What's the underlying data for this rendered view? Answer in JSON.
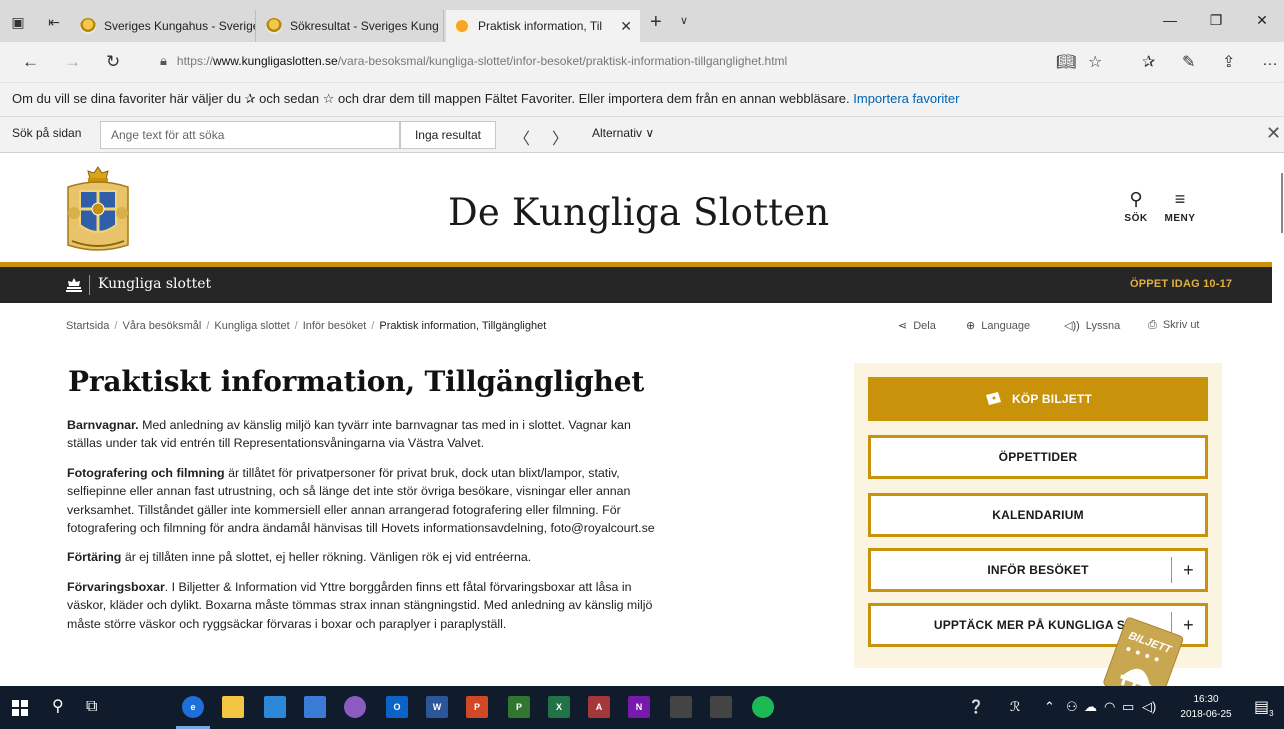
{
  "browser": {
    "tabs": [
      {
        "title": "Sveriges Kungahus - Sverige",
        "active": false
      },
      {
        "title": "Sökresultat - Sveriges Kung",
        "active": false
      },
      {
        "title": "Praktisk information, Til",
        "active": true
      }
    ],
    "tab_close_glyph": "✕",
    "new_tab_glyph": "+",
    "tab_list_glyph": "∨",
    "window_controls": {
      "minimize": "—",
      "restore": "❐",
      "close": "✕"
    },
    "nav": {
      "back": "←",
      "forward": "→",
      "refresh": "↻"
    },
    "url": {
      "prefix": "https://",
      "domain": "www.kungligaslotten.se",
      "path": "/vara-besoksmal/kungliga-slottet/infor-besoket/praktisk-information-tillganglighet.html"
    },
    "toolbar_icons": [
      "reading-view-icon",
      "favorite-star-icon",
      "favorites-hub-icon",
      "web-note-icon",
      "share-icon",
      "more-icon"
    ],
    "favbar": {
      "text": "Om du vill se dina favoriter här väljer du ✰ och sedan ☆ och drar dem till mappen Fältet Favoriter. Eller importera dem från en annan webbläsare.",
      "link": "Importera favoriter"
    },
    "find": {
      "label": "Sök på sidan",
      "placeholder": "Ange text för att söka",
      "result": "Inga resultat",
      "options": "Alternativ ∨",
      "prev": "〈",
      "next": "〉",
      "close": "✕"
    }
  },
  "site": {
    "title": "De Kungliga Slotten",
    "search_label": "SÖK",
    "menu_label": "MENY",
    "subnav_name": "Kungliga slottet",
    "open_today": "ÖPPET IDAG 10-17"
  },
  "breadcrumb": {
    "items": [
      "Startsida",
      "Våra besöksmål",
      "Kungliga slottet",
      "Inför besöket"
    ],
    "current": "Praktisk information, Tillgänglighet",
    "separator": "/"
  },
  "tools": {
    "share": "Dela",
    "language": "Language",
    "listen": "Lyssna",
    "print": "Skriv ut"
  },
  "article": {
    "title": "Praktiskt information, Tillgänglighet",
    "paragraphs": [
      {
        "lead": "Barnvagnar.",
        "text": " Med anledning av känslig miljö kan tyvärr inte barnvagnar tas med in i slottet. Vagnar kan ställas under tak vid entrén till Representationsvåningarna via Västra Valvet."
      },
      {
        "lead": "Fotografering och filmning",
        "text": " är tillåtet för privatpersoner för privat bruk, dock utan blixt/lampor, stativ, selfiepinne eller annan fast utrustning, och så länge det inte stör övriga besökare, visningar eller annan verksamhet. Tillståndet gäller inte kommersiell eller annan arrangerad fotografering eller filmning. För fotografering och filmning för andra ändamål hänvisas till Hovets informationsavdelning, foto@royalcourt.se"
      },
      {
        "lead": "Förtäring",
        "text": " är ej tillåten inne på slottet, ej heller rökning. Vänligen rök ej vid entréerna."
      },
      {
        "lead": "Förvaringsboxar",
        "text": ". I Biljetter & Information vid Yttre borggården finns ett fåtal förvaringsboxar att låsa in väskor, kläder och dylikt. Boxarna måste tömmas strax innan stängningstid. Med anledning av känslig miljö måste större väskor och ryggsäckar förvaras i boxar och paraplyer i paraplyställ."
      }
    ]
  },
  "sidebar": {
    "buy_ticket": "KÖP BILJETT",
    "opening_hours": "ÖPPETTIDER",
    "calendar": "KALENDARIUM",
    "before_visit": "INFÖR BESÖKET",
    "discover_more": "UPPTÄCK MER PÅ KUNGLIGA SLO",
    "plus": "+",
    "ticket_badge": "BILJETT"
  },
  "taskbar": {
    "apps": [
      {
        "name": "file-explorer",
        "label": "",
        "color": "#f4c542"
      },
      {
        "name": "store",
        "label": "",
        "color": "#2b88d8"
      },
      {
        "name": "photos",
        "label": "",
        "color": "#3a7bd5"
      },
      {
        "name": "app-purple",
        "label": "",
        "color": "#8a5cc2"
      },
      {
        "name": "outlook",
        "label": "O",
        "color": "#0a64c8"
      },
      {
        "name": "word",
        "label": "W",
        "color": "#2b579a"
      },
      {
        "name": "powerpoint",
        "label": "P",
        "color": "#d24726"
      },
      {
        "name": "project",
        "label": "P",
        "color": "#31752f"
      },
      {
        "name": "excel",
        "label": "X",
        "color": "#217346"
      },
      {
        "name": "access",
        "label": "A",
        "color": "#a4373a"
      },
      {
        "name": "onenote",
        "label": "N",
        "color": "#7719aa"
      },
      {
        "name": "calendar",
        "label": "",
        "color": "#444444"
      },
      {
        "name": "camera",
        "label": "",
        "color": "#444444"
      },
      {
        "name": "spotify",
        "label": "",
        "color": "#1db954"
      }
    ],
    "clock_time": "16:30",
    "clock_date": "2018-06-25",
    "notifications_count": "3"
  },
  "colors": {
    "gold": "#c8920a",
    "dark_nav": "#262626",
    "sidebar_bg": "#faf4e1",
    "link_blue": "#0063b1",
    "taskbar": "#101c2c"
  }
}
